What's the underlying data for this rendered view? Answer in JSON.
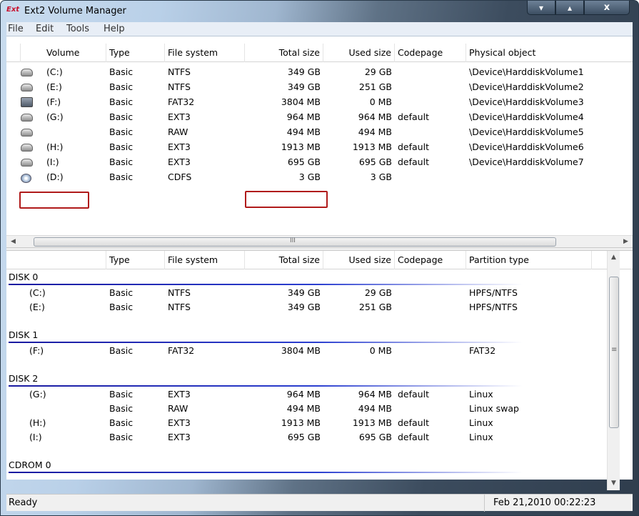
{
  "window": {
    "icon_label": "Ext",
    "title": "Ext2 Volume Manager",
    "minimize_glyph": "▾",
    "maximize_glyph": "▴",
    "close_glyph": "x"
  },
  "menu": [
    "File",
    "Edit",
    "Tools",
    "Help"
  ],
  "volumes": {
    "headers": [
      "Volume",
      "Type",
      "File system",
      "Total size",
      "Used size",
      "Codepage",
      "Physical object"
    ],
    "rows": [
      {
        "icon": "hard-drive-icon",
        "volume": "(C:)",
        "type": "Basic",
        "fs": "NTFS",
        "total": "349 GB",
        "used": "29 GB",
        "codepage": "",
        "physical": "\\Device\\HarddiskVolume1"
      },
      {
        "icon": "hard-drive-icon",
        "volume": "(E:)",
        "type": "Basic",
        "fs": "NTFS",
        "total": "349 GB",
        "used": "251 GB",
        "codepage": "",
        "physical": "\\Device\\HarddiskVolume2"
      },
      {
        "icon": "usb-drive-icon",
        "volume": "(F:)",
        "type": "Basic",
        "fs": "FAT32",
        "total": "3804 MB",
        "used": "0 MB",
        "codepage": "",
        "physical": "\\Device\\HarddiskVolume3"
      },
      {
        "icon": "hard-drive-icon",
        "volume": "(G:)",
        "type": "Basic",
        "fs": "EXT3",
        "total": "964 MB",
        "used": "964 MB",
        "codepage": "default",
        "physical": "\\Device\\HarddiskVolume4"
      },
      {
        "icon": "hard-drive-icon",
        "volume": "",
        "type": "Basic",
        "fs": "RAW",
        "total": "494 MB",
        "used": "494 MB",
        "codepage": "",
        "physical": "\\Device\\HarddiskVolume5"
      },
      {
        "icon": "hard-drive-icon",
        "volume": "(H:)",
        "type": "Basic",
        "fs": "EXT3",
        "total": "1913 MB",
        "used": "1913 MB",
        "codepage": "default",
        "physical": "\\Device\\HarddiskVolume6"
      },
      {
        "icon": "hard-drive-icon",
        "volume": "(I:)",
        "type": "Basic",
        "fs": "EXT3",
        "total": "695 GB",
        "used": "695 GB",
        "codepage": "default",
        "physical": "\\Device\\HarddiskVolume7"
      },
      {
        "icon": "cd-drive-icon",
        "volume": "(D:)",
        "type": "Basic",
        "fs": "CDFS",
        "total": "3 GB",
        "used": "3 GB",
        "codepage": "",
        "physical": ""
      }
    ],
    "hscroll_grip": "III"
  },
  "disks": {
    "headers": [
      "",
      "Type",
      "File system",
      "Total size",
      "Used size",
      "Codepage",
      "Partition type"
    ],
    "groups": [
      {
        "name": "DISK 0",
        "rows": [
          {
            "volume": "(C:)",
            "type": "Basic",
            "fs": "NTFS",
            "total": "349 GB",
            "used": "29 GB",
            "codepage": "",
            "ptype": "HPFS/NTFS"
          },
          {
            "volume": "(E:)",
            "type": "Basic",
            "fs": "NTFS",
            "total": "349 GB",
            "used": "251 GB",
            "codepage": "",
            "ptype": "HPFS/NTFS"
          }
        ]
      },
      {
        "name": "DISK 1",
        "rows": [
          {
            "volume": "(F:)",
            "type": "Basic",
            "fs": "FAT32",
            "total": "3804 MB",
            "used": "0 MB",
            "codepage": "",
            "ptype": "FAT32"
          }
        ]
      },
      {
        "name": "DISK 2",
        "rows": [
          {
            "volume": "(G:)",
            "type": "Basic",
            "fs": "EXT3",
            "total": "964 MB",
            "used": "964 MB",
            "codepage": "default",
            "ptype": "Linux"
          },
          {
            "volume": "",
            "type": "Basic",
            "fs": "RAW",
            "total": "494 MB",
            "used": "494 MB",
            "codepage": "",
            "ptype": "Linux swap"
          },
          {
            "volume": "(H:)",
            "type": "Basic",
            "fs": "EXT3",
            "total": "1913 MB",
            "used": "1913 MB",
            "codepage": "default",
            "ptype": "Linux"
          },
          {
            "volume": "(I:)",
            "type": "Basic",
            "fs": "EXT3",
            "total": "695 GB",
            "used": "695 GB",
            "codepage": "default",
            "ptype": "Linux"
          }
        ]
      },
      {
        "name": "CDROM 0",
        "rows": []
      }
    ],
    "vscroll_grip": "≡"
  },
  "status": {
    "left": "Ready",
    "right": "Feb 21,2010 00:22:23"
  },
  "colors": {
    "highlight_box": "#b01a1a",
    "disk_line": "#1a1aa0"
  }
}
